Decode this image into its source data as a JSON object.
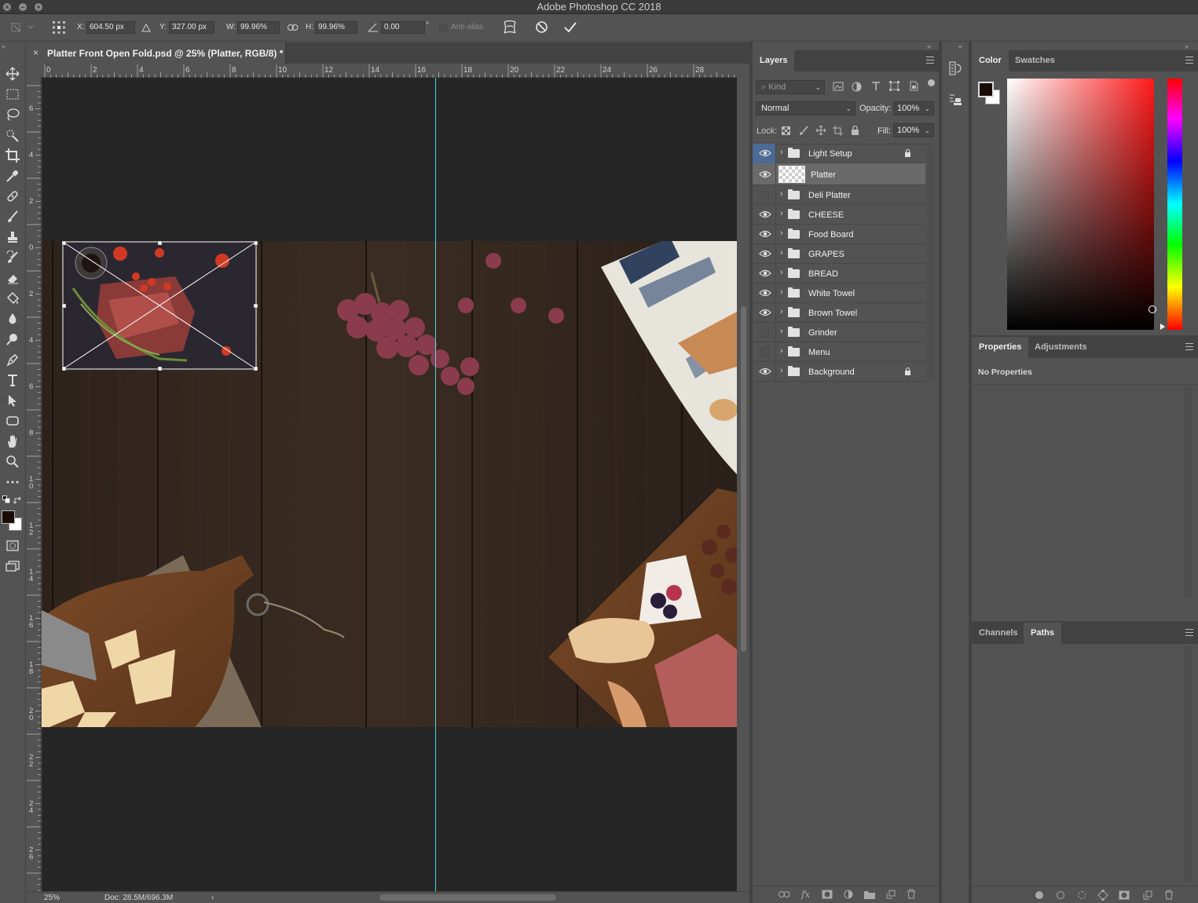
{
  "app": {
    "title": "Adobe Photoshop CC 2018"
  },
  "options_bar": {
    "x_label": "X:",
    "x_value": "604.50 px",
    "y_label": "Y:",
    "y_value": "327.00 px",
    "w_label": "W:",
    "w_value": "99.96%",
    "h_label": "H:",
    "h_value": "99.96%",
    "angle_value": "0.00",
    "angle_unit": "°",
    "antialias_label": "Anti-alias"
  },
  "document": {
    "tab_close": "×",
    "tab_title": "Platter Front Open Fold.psd @ 25% (Platter, RGB/8) *",
    "zoom": "25%",
    "doc_info": "Doc: 28.5M/696.3M",
    "status_arrow": "›"
  },
  "ruler": {
    "horizontal": [
      "0",
      "2",
      "4",
      "6",
      "8",
      "10",
      "12",
      "14",
      "16",
      "18",
      "20",
      "22",
      "24",
      "26",
      "28"
    ],
    "vertical": [
      "6",
      "4",
      "2",
      "0",
      "2",
      "4",
      "6",
      "8",
      "10",
      "12",
      "14",
      "16",
      "18",
      "20",
      "22",
      "24",
      "26"
    ]
  },
  "layers_panel": {
    "tab": "Layers",
    "filter_label": "Kind",
    "blend_mode": "Normal",
    "opacity_label": "Opacity:",
    "opacity_value": "100%",
    "lock_label": "Lock:",
    "fill_label": "Fill:",
    "fill_value": "100%",
    "layers": [
      {
        "name": "Light Setup",
        "visible": true,
        "type": "group",
        "locked": true
      },
      {
        "name": "Platter",
        "visible": true,
        "type": "smart",
        "locked": false,
        "selected": true
      },
      {
        "name": "Deli Platter",
        "visible": false,
        "type": "group",
        "locked": false
      },
      {
        "name": "CHEESE",
        "visible": true,
        "type": "group",
        "locked": false
      },
      {
        "name": "Food Board",
        "visible": true,
        "type": "group",
        "locked": false
      },
      {
        "name": "GRAPES",
        "visible": true,
        "type": "group",
        "locked": false
      },
      {
        "name": "BREAD",
        "visible": true,
        "type": "group",
        "locked": false
      },
      {
        "name": "White Towel",
        "visible": true,
        "type": "group",
        "locked": false
      },
      {
        "name": "Brown Towel",
        "visible": true,
        "type": "group",
        "locked": false
      },
      {
        "name": "Grinder",
        "visible": false,
        "type": "group",
        "locked": false
      },
      {
        "name": "Menu",
        "visible": false,
        "type": "group",
        "locked": false
      },
      {
        "name": "Background",
        "visible": true,
        "type": "group",
        "locked": true
      }
    ]
  },
  "color_panel": {
    "tabs": [
      "Color",
      "Swatches"
    ],
    "foreground": "#1a0a08",
    "background": "#ffffff"
  },
  "properties_panel": {
    "tabs": [
      "Properties",
      "Adjustments"
    ],
    "message": "No Properties"
  },
  "paths_panel": {
    "tabs": [
      "Channels",
      "Paths"
    ]
  },
  "colors": {
    "guide": "#4fd6e6",
    "selected_layer": "#6a6a6a",
    "ui_bg": "#535353"
  }
}
